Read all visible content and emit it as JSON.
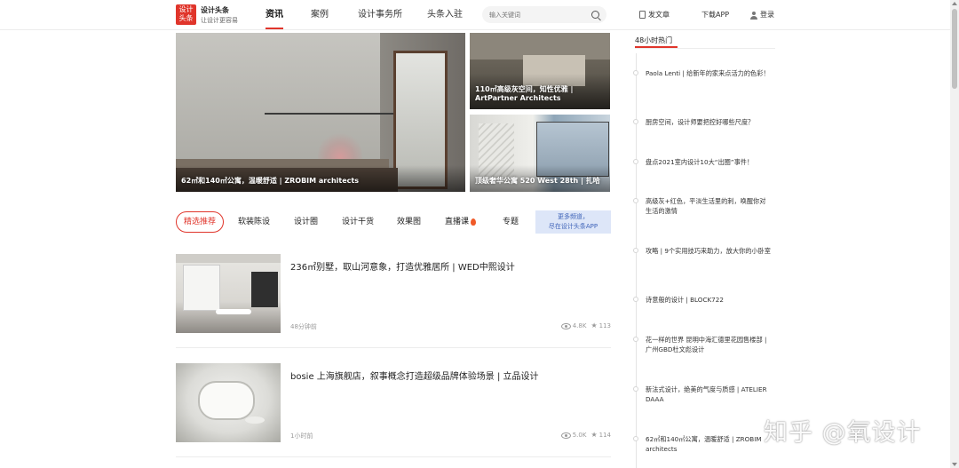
{
  "header": {
    "logo_line1": "设计",
    "logo_line2": "头条",
    "brand_name": "设计头条",
    "brand_slogan": "让设计更容易",
    "nav": [
      {
        "label": "资讯",
        "active": true
      },
      {
        "label": "案例",
        "active": false
      },
      {
        "label": "设计事务所",
        "active": false
      },
      {
        "label": "头条入驻",
        "active": false
      }
    ],
    "search_placeholder": "输入关键词",
    "post_label": "发文章",
    "download_label": "下载APP",
    "login_label": "登录",
    "accent_color": "#e0352b"
  },
  "hero": [
    {
      "caption": "62㎡和140㎡公寓，温暖舒适 | ZROBIM architects"
    },
    {
      "caption": "110㎡高级灰空间，知性优雅 | ArtPartner Architects"
    },
    {
      "caption": "顶级奢华公寓 520 West 28th | 扎哈"
    }
  ],
  "tabs": [
    {
      "label": "精选推荐",
      "active": true
    },
    {
      "label": "软装陈设",
      "active": false
    },
    {
      "label": "设计圈",
      "active": false
    },
    {
      "label": "设计干货",
      "active": false
    },
    {
      "label": "效果图",
      "active": false
    },
    {
      "label": "直播课",
      "active": false
    },
    {
      "label": "专题",
      "active": false
    }
  ],
  "more_channels": {
    "line1": "更多频道，",
    "line2": "尽在设计头条APP"
  },
  "articles": [
    {
      "title": "236㎡别墅，取山河意象，打造优雅居所 | WED中熙设计",
      "time": "48分钟前",
      "views": "4.8K",
      "stars": "113"
    },
    {
      "title": "bosie 上海旗舰店，叙事概念打造超级品牌体验场景 | 立品设计",
      "time": "1小时前",
      "views": "5.0K",
      "stars": "114"
    }
  ],
  "sidebar": {
    "title": "48小时热门",
    "items": [
      "Paola Lenti | 给新年的家来点活力的色彩！",
      "厨房空间，设计师要把控好哪些尺度？",
      "盘点2021室内设计10大“出圈”事件！",
      "高级灰+红色，平淡生活里的刺，唤醒你对生活的激情",
      "攻略 | 9个实用技巧来助力，放大你的小卧室",
      "诗意般的设计 | BLOCK722",
      "花一样的世界 昆明中海汇德里花园售楼部 | 广州GBD杜文彪设计",
      "新法式设计，绝美的气度与质感 | ATELIER DAAA",
      "62㎡和140㎡公寓，温暖舒适 | ZROBIM architects"
    ]
  },
  "watermark": "知乎 @氧设计"
}
